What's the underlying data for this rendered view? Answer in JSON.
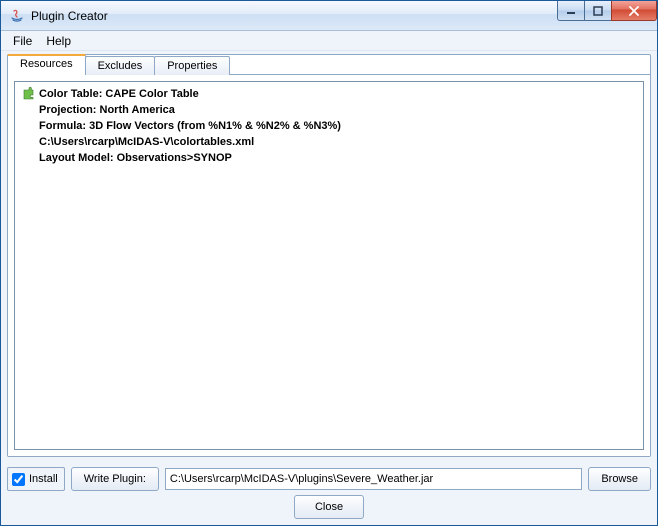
{
  "window": {
    "title": "Plugin Creator"
  },
  "menubar": {
    "file": "File",
    "help": "Help"
  },
  "tabs": {
    "resources": "Resources",
    "excludes": "Excludes",
    "properties": "Properties"
  },
  "resources": {
    "items": [
      "Color Table: CAPE Color Table",
      "Projection: North America",
      "Formula: 3D Flow Vectors (from %N1% & %N2% & %N3%)",
      "C:\\Users\\rcarp\\McIDAS-V\\colortables.xml",
      "Layout Model: Observations>SYNOP"
    ]
  },
  "bottom": {
    "install_label": "Install",
    "install_checked": true,
    "write_plugin": "Write Plugin:",
    "path": "C:\\Users\\rcarp\\McIDAS-V\\plugins\\Severe_Weather.jar",
    "browse": "Browse",
    "close": "Close"
  }
}
